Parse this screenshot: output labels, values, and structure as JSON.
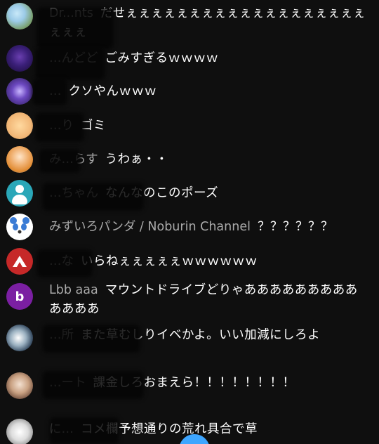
{
  "chat": {
    "messages": [
      {
        "author": "Dr...nts",
        "text": "だせぇぇぇぇぇぇぇぇぇぇぇぇぇぇぇぇぇぇぇぇぇぇ"
      },
      {
        "author": "…んどど",
        "text": "ごみすぎるｗｗｗｗ"
      },
      {
        "author": "…",
        "text": "クソやんｗｗｗ"
      },
      {
        "author": "…り",
        "text": "ゴミ"
      },
      {
        "author": "み…らす",
        "text": "うわぁ・・"
      },
      {
        "author": "…ちゃん",
        "text": "なんなのこのポーズ"
      },
      {
        "author": "みずいろパンダ / Noburin Channel",
        "text": "？？？？？？"
      },
      {
        "author": "…な",
        "text": "いらねぇぇぇぇぇｗｗｗｗｗｗ"
      },
      {
        "author": "Lbb aaa",
        "text": "マウントドライブどりゃあああああああああああああ"
      },
      {
        "author": "…所",
        "text": "また草むしりイベかよ。いい加減にしろよ"
      },
      {
        "author": "…ート",
        "text": "課金しろおまえら！！！！！！！！"
      },
      {
        "author": "に…",
        "text": "コメ欄予想通りの荒れ具合で草"
      }
    ]
  },
  "icons": {
    "avatar_9_letter": "b"
  },
  "colors": {
    "background": "#0f0f0f",
    "author": "#aaaaaa",
    "message": "#ffffff",
    "accent": "#3ea6ff"
  }
}
